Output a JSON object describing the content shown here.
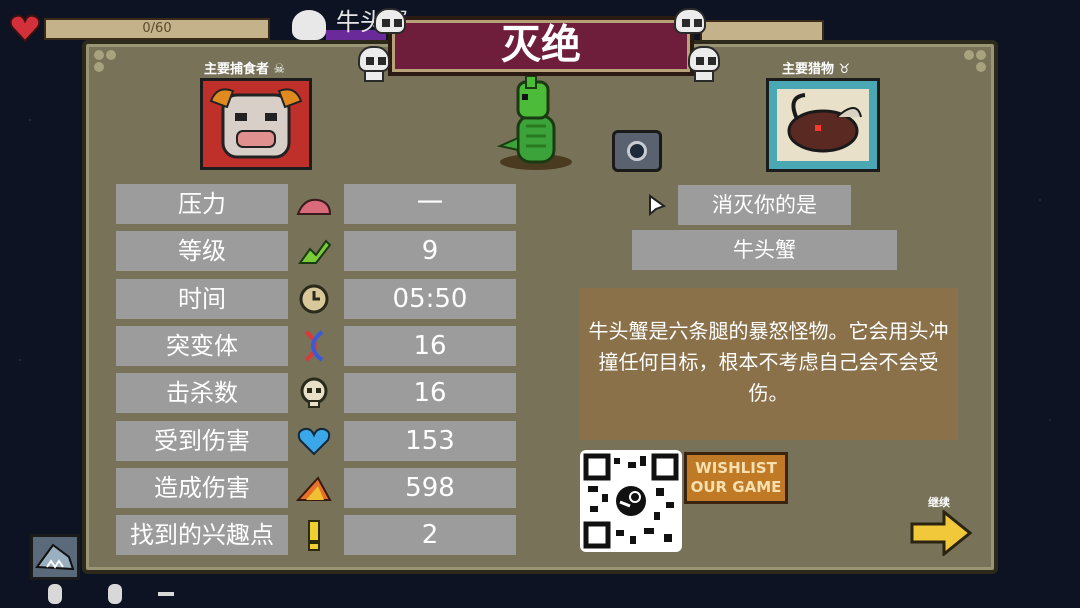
{
  "hud": {
    "xp_text": "0/60",
    "enemy_name": "牛头蟹"
  },
  "panel": {
    "title": "灭绝",
    "predator_label": "主要捕食者",
    "prey_label": "主要猎物",
    "stats": [
      {
        "label": "压力",
        "value": "一",
        "icon": "pressure-icon"
      },
      {
        "label": "等级",
        "value": "9",
        "icon": "level-up-icon"
      },
      {
        "label": "时间",
        "value": "05:50",
        "icon": "clock-icon"
      },
      {
        "label": "突变体",
        "value": "16",
        "icon": "dna-icon"
      },
      {
        "label": "击杀数",
        "value": "16",
        "icon": "skull-kills-icon"
      },
      {
        "label": "受到伤害",
        "value": "153",
        "icon": "heart-icon"
      },
      {
        "label": "造成伤害",
        "value": "598",
        "icon": "damage-icon"
      },
      {
        "label": "找到的兴趣点",
        "value": "2",
        "icon": "exclamation-icon"
      }
    ],
    "killed_by_label": "消灭你的是",
    "killer_name": "牛头蟹",
    "description": "牛头蟹是六条腿的暴怒怪物。它会用头冲撞任何目标，根本不考虑自己会不会受伤。",
    "wishlist_text": "WISHLIST OUR GAME",
    "continue_label": "继续"
  },
  "colors": {
    "panel_bg": "#777258",
    "title_banner": "#6e1e3a",
    "stat_box": "#9c9c9c",
    "description_bg": "#8a7149"
  }
}
